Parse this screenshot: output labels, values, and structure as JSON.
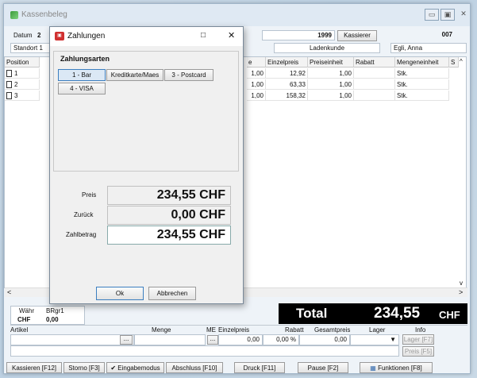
{
  "window": {
    "title": "Kassenbeleg",
    "controls": [
      "▭",
      "▣",
      "✕"
    ]
  },
  "header": {
    "datum_label": "Datum",
    "datum_value": "2",
    "standort_label": "Standort",
    "standort_value": "1",
    "beleg_nr": "1999",
    "kassierer_button": "Kassierer",
    "kassierer_nr": "007",
    "kunde": "Ladenkunde",
    "kassierer_name": "Egli, Anna"
  },
  "grid": {
    "columns": [
      "Position",
      "e",
      "Einzelpreis",
      "Preiseinheit",
      "Rabatt",
      "Mengeneinheit",
      "S"
    ],
    "rows": [
      {
        "pos": "1",
        "menge": "1,00",
        "einzelpreis": "12,92",
        "preiseinheit": "1,00",
        "rabatt": "",
        "me": "Stk."
      },
      {
        "pos": "2",
        "menge": "1,00",
        "einzelpreis": "63,33",
        "preiseinheit": "1,00",
        "rabatt": "",
        "me": "Stk."
      },
      {
        "pos": "3",
        "menge": "1,00",
        "einzelpreis": "158,32",
        "preiseinheit": "1,00",
        "rabatt": "",
        "me": "Stk."
      }
    ]
  },
  "dialog": {
    "title": "Zahlungen",
    "group_title": "Zahlungsarten",
    "payment_buttons": [
      "1 - Bar",
      "Kreditkarte/Maes",
      "3 - Postcard",
      "4 - VISA"
    ],
    "preis_label": "Preis",
    "preis_value": "234,55 CHF",
    "zurueck_label": "Zurück",
    "zurueck_value": "0,00 CHF",
    "zahlbetrag_label": "Zahlbetrag",
    "zahlbetrag_value": "234,55 CHF",
    "ok_button": "Ok",
    "cancel_button": "Abbrechen"
  },
  "currency": {
    "waehr_label": "Währ",
    "waehr_value": "BRgr1",
    "chf_label": "CHF",
    "chf_value": "0,00"
  },
  "total": {
    "label": "Total",
    "value": "234,55",
    "currency": "CHF"
  },
  "entry": {
    "headers": [
      "Artikel",
      "Menge",
      "ME",
      "Einzelpreis",
      "Rabatt",
      "Gesamtpreis",
      "Lager",
      "Info"
    ],
    "einzelpreis": "0,00",
    "rabatt": "0,00 %",
    "gesamtpreis": "0,00",
    "lager_button": "Lager [F7]",
    "preis_button": "Preis [F5]"
  },
  "bottom_buttons": [
    "Kassieren [F12]",
    "Storno [F3]",
    "✔ Eingabemodus",
    "Abschluss [F10]",
    "Druck [F11]",
    "Pause [F2]",
    "Funktionen [F8]"
  ]
}
